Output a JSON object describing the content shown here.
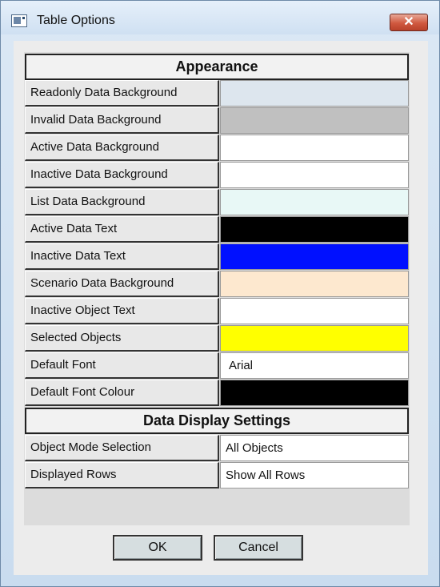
{
  "window": {
    "title": "Table Options"
  },
  "appearance": {
    "header": "Appearance",
    "rows": [
      {
        "label": "Readonly Data Background",
        "value": "",
        "color": "#dde6ee"
      },
      {
        "label": "Invalid Data Background",
        "value": "",
        "color": "#c0c0c0"
      },
      {
        "label": "Active Data Background",
        "value": "",
        "color": "#ffffff"
      },
      {
        "label": "Inactive Data Background",
        "value": "",
        "color": "#ffffff"
      },
      {
        "label": "List Data Background",
        "value": "",
        "color": "#e8f8f6"
      },
      {
        "label": "Active Data Text",
        "value": "",
        "color": "#000000"
      },
      {
        "label": "Inactive Data Text",
        "value": "",
        "color": "#0010ff"
      },
      {
        "label": "Scenario Data Background",
        "value": "",
        "color": "#fde8cf"
      },
      {
        "label": "Inactive Object Text",
        "value": "",
        "color": "#ffffff"
      },
      {
        "label": "Selected Objects",
        "value": "",
        "color": "#ffff00"
      },
      {
        "label": "Default Font",
        "value": "Arial",
        "color": "#ffffff"
      },
      {
        "label": "Default Font Colour",
        "value": "",
        "color": "#000000"
      }
    ]
  },
  "display": {
    "header": "Data Display Settings",
    "rows": [
      {
        "label": "Object Mode Selection",
        "value": "All Objects",
        "color": "#ffffff"
      },
      {
        "label": "Displayed Rows",
        "value": "Show All Rows",
        "color": "#ffffff"
      }
    ]
  },
  "buttons": {
    "ok": "OK",
    "cancel": "Cancel"
  },
  "icons": {
    "app": "table-options-window-icon",
    "close": "close-icon",
    "close_glyph": "✕"
  }
}
